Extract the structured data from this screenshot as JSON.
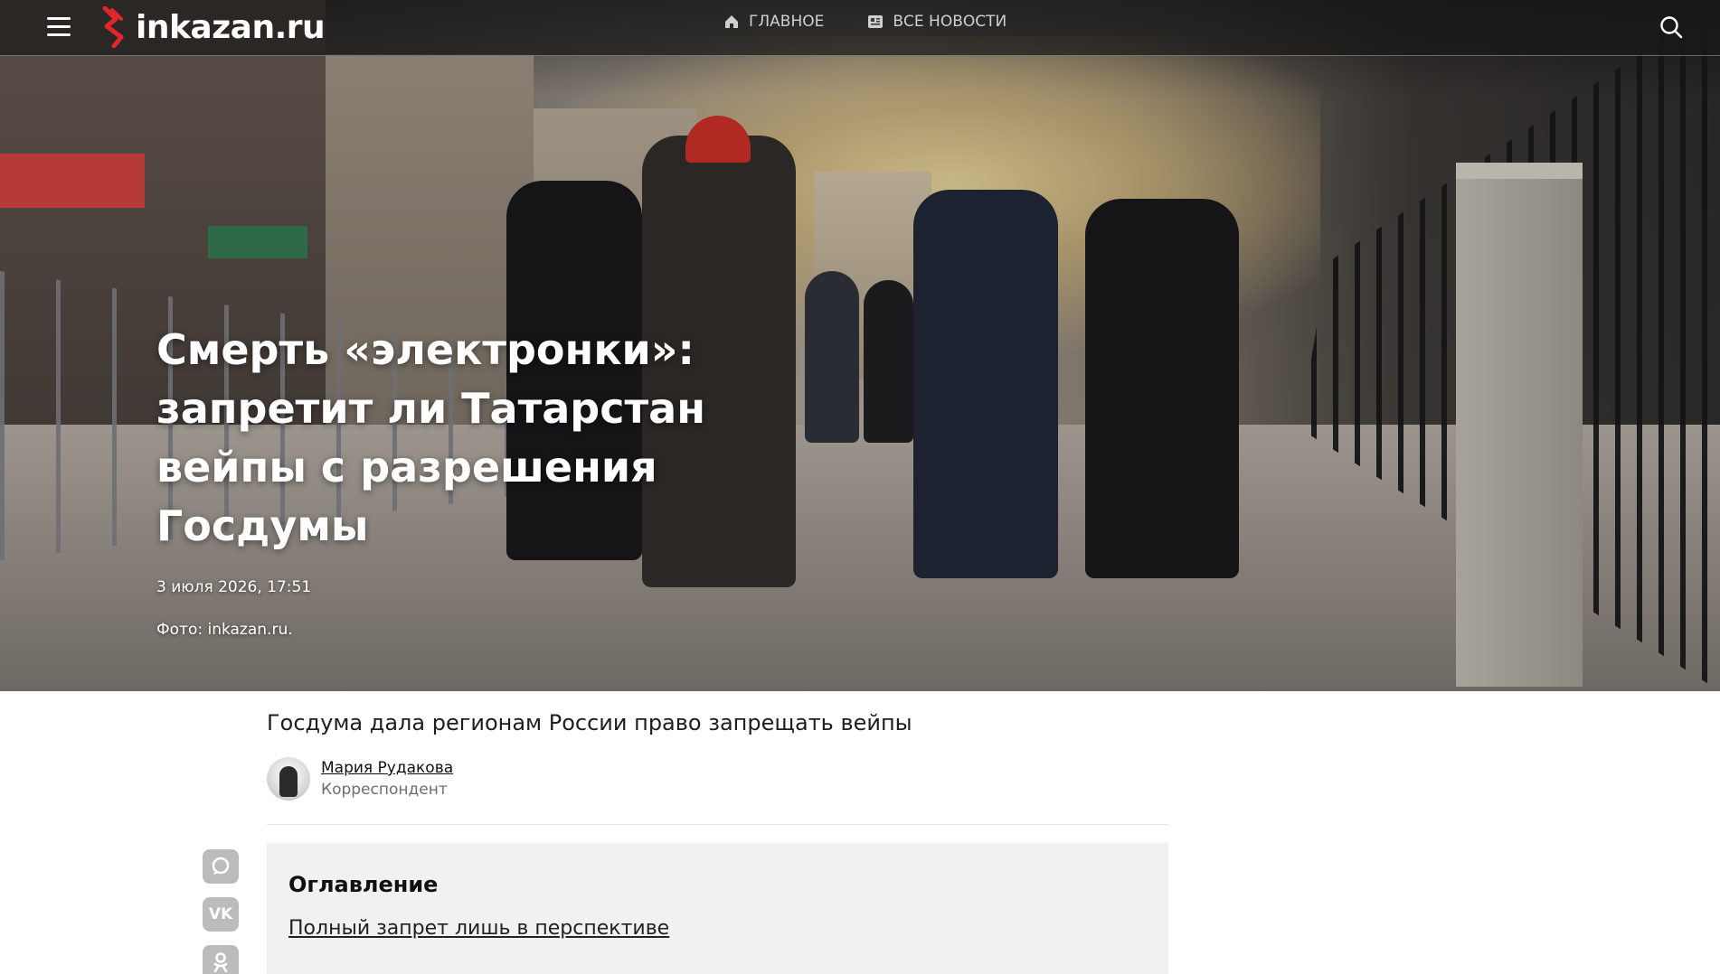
{
  "header": {
    "logo_text": "inkazan.ru",
    "nav": [
      {
        "label": "ГЛАВНОЕ",
        "icon": "home-icon"
      },
      {
        "label": "ВСЕ НОВОСТИ",
        "icon": "newspaper-icon"
      }
    ]
  },
  "hero": {
    "title": "Смерть «электронки»: запретит ли Татарстан вейпы с разрешения Госдумы",
    "date": "3 июля 2026, 17:51",
    "photo_credit": "Фото: inkazan.ru."
  },
  "article": {
    "lead": "Госдума дала регионам России право запрещать вейпы",
    "author": {
      "name": "Мария Рудакова",
      "role": "Корреспондент"
    }
  },
  "share": [
    {
      "icon": "max-chat-icon",
      "label": ""
    },
    {
      "icon": "vk-icon",
      "label": "VK"
    },
    {
      "icon": "odnoklassniki-icon",
      "label": ""
    }
  ],
  "toc": {
    "title": "Оглавление",
    "items": [
      "Полный запрет лишь в перспективе"
    ]
  },
  "colors": {
    "logo_accent": "#e2262b",
    "header_bg": "#191919",
    "toc_bg": "#f1f1f1",
    "share_btn": "#bcbcbc"
  }
}
